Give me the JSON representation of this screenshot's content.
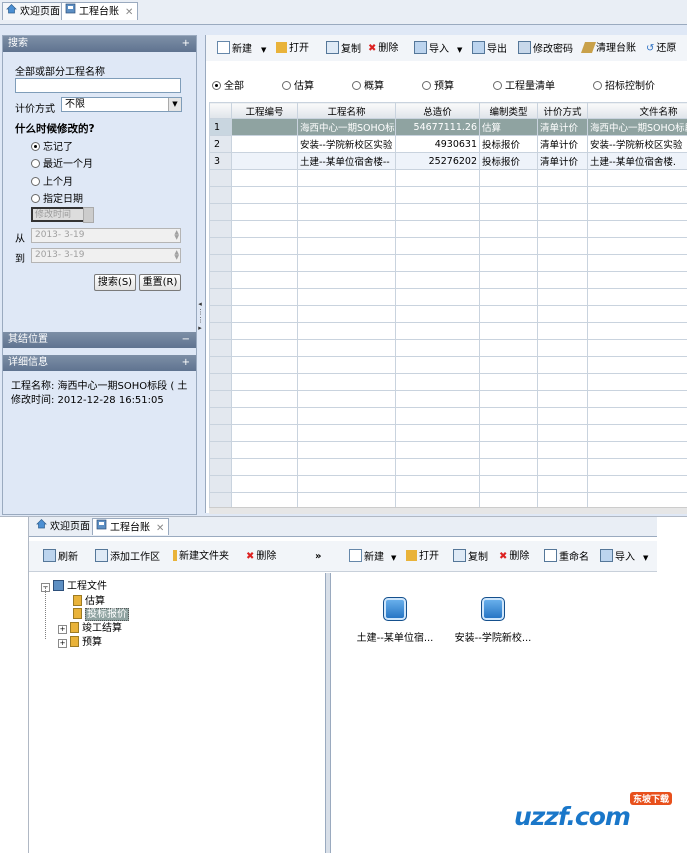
{
  "top": {
    "tabs": [
      {
        "label": "欢迎页面"
      },
      {
        "label": "工程台账"
      }
    ],
    "search_panel": {
      "title": "搜索",
      "name_label": "全部或部分工程名称",
      "name_value": "",
      "pricing_label": "计价方式",
      "pricing_value": "不限",
      "when_label": "什么时候修改的?",
      "options": [
        "忘记了",
        "最近一个月",
        "上个月",
        "指定日期"
      ],
      "selected_option": "忘记了",
      "modify_time_placeholder": "修改时间",
      "from_label": "从",
      "from_value": "2013- 3-19",
      "to_label": "到",
      "to_value": "2013- 3-19",
      "search_button": "搜索(S)",
      "reset_button": "重置(R)"
    },
    "estimate_panel": {
      "title": "其结位置"
    },
    "detail_panel": {
      "title": "详细信息",
      "name_line": "工程名称: 海西中心一期SOHO标段 ( 土",
      "time_line": "修改时间: 2012-12-28 16:51:05"
    },
    "toolbar": [
      "新建",
      "打开",
      "复制",
      "删除",
      "导入",
      "导出",
      "修改密码",
      "清理台账",
      "还原"
    ],
    "filters": [
      "全部",
      "估算",
      "概算",
      "预算",
      "工程量清单",
      "招标控制价"
    ],
    "selected_filter": "全部",
    "table": {
      "columns": [
        "工程编号",
        "工程名称",
        "总造价",
        "编制类型",
        "计价方式",
        "文件名称"
      ],
      "rows": [
        {
          "n": "1",
          "code": "",
          "name": "海西中心一期SOHO标段",
          "total": "54677111.26",
          "type": "估算",
          "method": "清单计价",
          "file": "海西中心一期SOHO标段"
        },
        {
          "n": "2",
          "code": "",
          "name": "安装--学院新校区实验",
          "total": "4930631",
          "type": "投标报价",
          "method": "清单计价",
          "file": "安装--学院新校区实验"
        },
        {
          "n": "3",
          "code": "",
          "name": "土建--某单位宿舍楼--",
          "total": "25276202",
          "type": "投标报价",
          "method": "清单计价",
          "file": "土建--某单位宿舍楼."
        }
      ]
    }
  },
  "bottom": {
    "tabs": [
      {
        "label": "欢迎页面"
      },
      {
        "label": "工程台账"
      }
    ],
    "left_toolbar": [
      "刷新",
      "添加工作区",
      "新建文件夹",
      "删除"
    ],
    "more": "»",
    "right_toolbar": [
      "新建",
      "打开",
      "复制",
      "删除",
      "重命名",
      "导入"
    ],
    "tree": {
      "root": "工程文件",
      "children": [
        "估算",
        "投标报价",
        "竣工结算",
        "预算"
      ],
      "selected": "投标报价"
    },
    "files": [
      "土建--某单位宿...",
      "安装--学院新校..."
    ]
  },
  "watermark": {
    "text": "uzzf.com",
    "sub": "东坡下载"
  },
  "colors": {
    "header": "#6b7f9a",
    "panel": "#dfe8f6",
    "selected_row": "#8fa3a1",
    "accent": "#1a77c9"
  }
}
